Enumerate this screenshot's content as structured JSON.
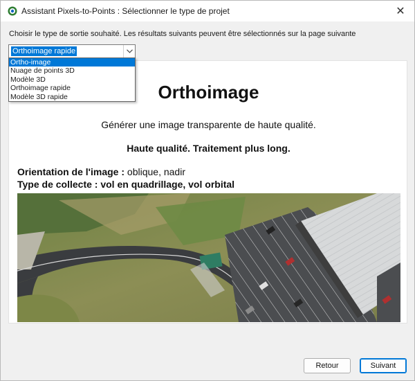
{
  "window": {
    "title": "Assistant Pixels-to-Points : Sélectionner le type de projet",
    "close_glyph": "✕"
  },
  "instruction": "Choisir le type de sortie souhaité. Les résultats suivants peuvent être sélectionnés sur la page suivante",
  "output_type": {
    "selected": "Orthoimage rapide",
    "options": [
      {
        "label": "Ortho-image",
        "highlighted": true
      },
      {
        "label": "Nuage de points 3D",
        "highlighted": false
      },
      {
        "label": "Modèle 3D",
        "highlighted": false
      },
      {
        "label": "Orthoimage rapide",
        "highlighted": false
      },
      {
        "label": "Modèle 3D rapide",
        "highlighted": false
      }
    ]
  },
  "description": {
    "heading": "Orthoimage",
    "subtitle": "Générer une image transparente de haute qualité.",
    "quality": "Haute qualité. Traitement plus long.",
    "orientation_label": "Orientation de l'image :",
    "orientation_value": "oblique, nadir",
    "collect_label": "Type de collecte :",
    "collect_value": "vol en quadrillage, vol orbital"
  },
  "buttons": {
    "back": "Retour",
    "next": "Suivant"
  },
  "colors": {
    "accent": "#0078d7",
    "window_bg": "#f0f0f0"
  },
  "icons": {
    "app": "app-logo-icon",
    "close": "close-icon",
    "dropdown": "chevron-down-icon"
  }
}
